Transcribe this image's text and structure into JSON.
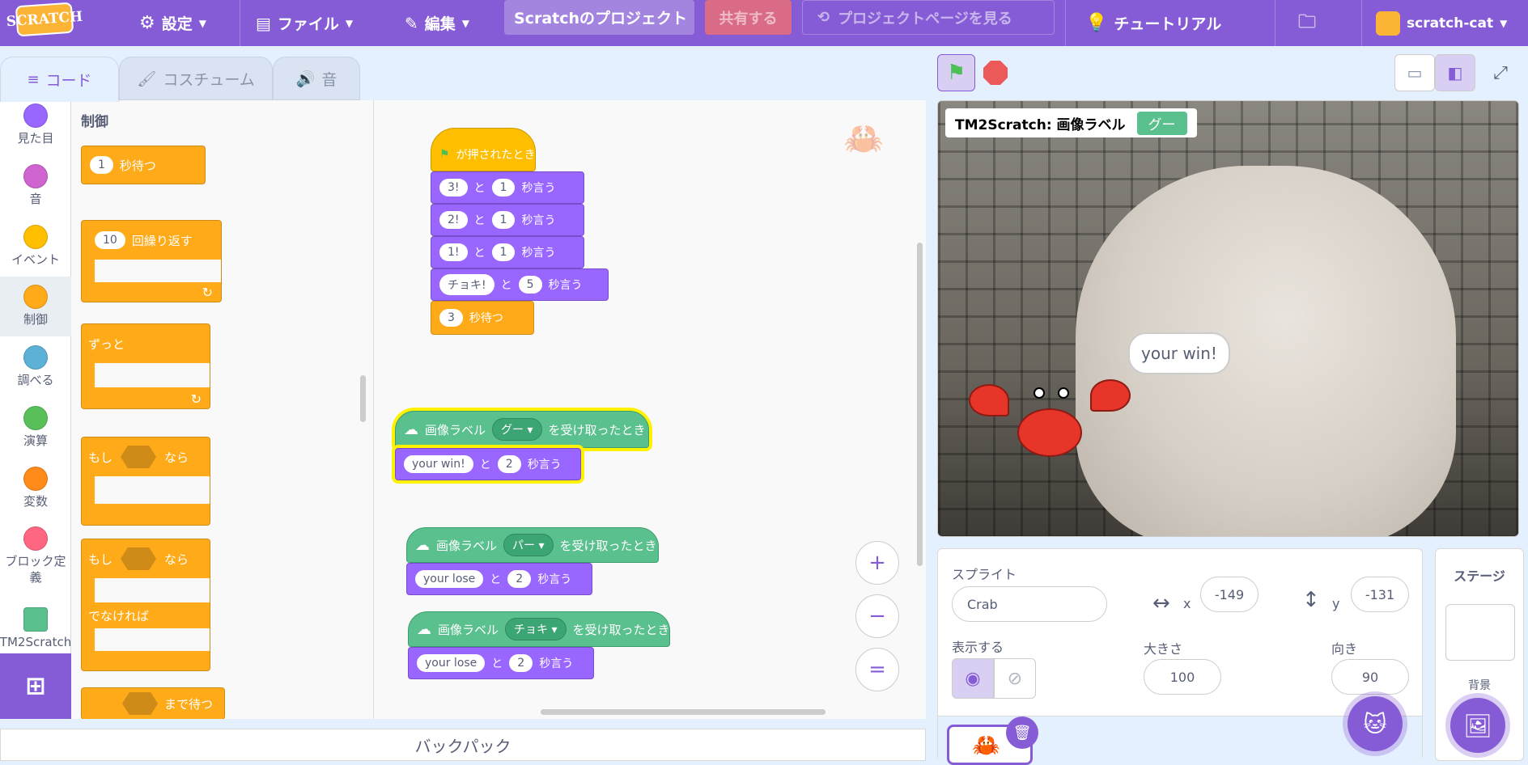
{
  "menubar": {
    "logo": "SCRATCH",
    "settings": "設定",
    "file": "ファイル",
    "edit": "編集",
    "project_title": "Scratchのプロジェクト",
    "share": "共有する",
    "see_project_page": "プロジェクトページを見る",
    "tutorials": "チュートリアル",
    "username": "scratch-cat"
  },
  "tabs": {
    "code": "コード",
    "costumes": "コスチューム",
    "sounds": "音"
  },
  "categories": [
    {
      "label": "見た目",
      "color": "#9966ff"
    },
    {
      "label": "音",
      "color": "#cf63cf"
    },
    {
      "label": "イベント",
      "color": "#ffbf00"
    },
    {
      "label": "制御",
      "color": "#ffab19"
    },
    {
      "label": "調べる",
      "color": "#5cb1d6"
    },
    {
      "label": "演算",
      "color": "#59c059"
    },
    {
      "label": "変数",
      "color": "#ff8c1a"
    },
    {
      "label": "ブロック定義",
      "color": "#ff6680"
    },
    {
      "label": "TM2Scratch",
      "color": "#59c08e"
    }
  ],
  "palette": {
    "heading": "制御",
    "wait_value": "1",
    "wait_label": "秒待つ",
    "repeat_value": "10",
    "repeat_label": "回繰り返す",
    "forever_label": "ずっと",
    "if_label": "もし",
    "then_label": "なら",
    "else_label": "でなければ",
    "wait_until_label": "まで待つ"
  },
  "scripts": {
    "hat_flag_label": "が押されたとき",
    "say1": {
      "text": "3!",
      "and": "と",
      "secs": "1",
      "label": "秒言う"
    },
    "say2": {
      "text": "2!",
      "and": "と",
      "secs": "1",
      "label": "秒言う"
    },
    "say3": {
      "text": "1!",
      "and": "と",
      "secs": "1",
      "label": "秒言う"
    },
    "say4": {
      "text": "チョキ!",
      "and": "と",
      "secs": "5",
      "label": "秒言う"
    },
    "wait": {
      "value": "3",
      "label": "秒待つ"
    },
    "hat1": {
      "prefix": "画像ラベル",
      "label": "グー",
      "suffix": "を受け取ったとき"
    },
    "say5": {
      "text": "your win!",
      "and": "と",
      "secs": "2",
      "label": "秒言う"
    },
    "hat2": {
      "prefix": "画像ラベル",
      "label": "パー",
      "suffix": "を受け取ったとき"
    },
    "say6": {
      "text": "your lose",
      "and": "と",
      "secs": "2",
      "label": "秒言う"
    },
    "hat3": {
      "prefix": "画像ラベル",
      "label": "チョキ",
      "suffix": "を受け取ったとき"
    },
    "say7": {
      "text": "your lose",
      "and": "と",
      "secs": "2",
      "label": "秒言う"
    }
  },
  "zoom": {
    "in": "+",
    "out": "−",
    "reset": "="
  },
  "backpack": "バックパック",
  "stage": {
    "monitor_label": "TM2Scratch: 画像ラベル",
    "monitor_value": "グー",
    "speech": "your win!"
  },
  "sprite_info": {
    "sprite_label": "スプライト",
    "name": "Crab",
    "x_label": "x",
    "x": "-149",
    "y_label": "y",
    "y": "-131",
    "show_label": "表示する",
    "size_label": "大きさ",
    "size": "100",
    "direction_label": "向き",
    "direction": "90"
  },
  "stage_pane": {
    "label": "ステージ",
    "backdrops_label": "背景"
  }
}
